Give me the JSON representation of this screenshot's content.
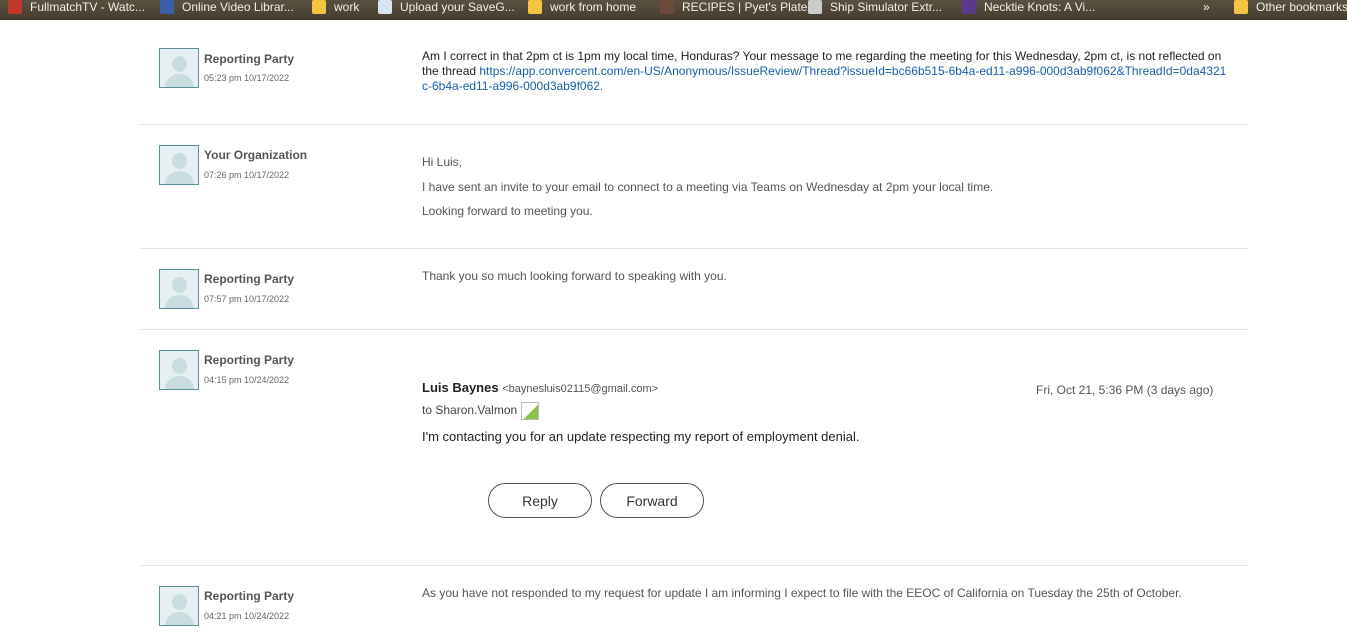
{
  "bookmarks": [
    {
      "label": "FullmatchTV - Watc...",
      "color": "#c0392b"
    },
    {
      "label": "Online Video Librar...",
      "color": "#3b5fa8"
    },
    {
      "label": "work",
      "color": "#f5c542"
    },
    {
      "label": "Upload your SaveG...",
      "color": "#d8e4f0"
    },
    {
      "label": "work from home",
      "color": "#f5c542"
    },
    {
      "label": "RECIPES | Pyet's Plate",
      "color": "#6b4a3a"
    },
    {
      "label": "Ship Simulator Extr...",
      "color": "#cccccc"
    },
    {
      "label": "Necktie Knots: A Vi...",
      "color": "#5b3a8c"
    }
  ],
  "bookmarks_overflow": "»",
  "other_bookmarks": "Other bookmarks",
  "messages": [
    {
      "author": "Reporting Party",
      "time": "05:23 pm 10/17/2022",
      "text": "Am I correct in that 2pm ct is 1pm my local time, Honduras? Your message to me regarding the meeting for this Wednesday, 2pm ct, is not reflected on the thread ",
      "link": "https://app.convercent.com/en-US/Anonymous/IssueReview/Thread?issueId=bc66b515-6b4a-ed11-a996-000d3ab9f062&ThreadId=0da4321c-6b4a-ed11-a996-000d3ab9f062."
    },
    {
      "author": "Your Organization",
      "time": "07:26 pm 10/17/2022",
      "lines": [
        "Hi Luis,",
        "I have sent an invite to your email to connect to a meeting via Teams on Wednesday at 2pm your local time.",
        "Looking forward to meeting you."
      ]
    },
    {
      "author": "Reporting Party",
      "time": "07:57 pm 10/17/2022",
      "text": "Thank you so much looking forward to speaking with you."
    },
    {
      "author": "Reporting Party",
      "time": "04:15 pm 10/24/2022",
      "email": {
        "sender": "Luis Baynes",
        "address": "<baynesluis02115@gmail.com>",
        "date": "Fri, Oct 21, 5:36 PM (3 days ago)",
        "to": "to Sharon.Valmon",
        "body": "I'm contacting you for an update respecting my report of  employment denial.",
        "reply": "Reply",
        "forward": "Forward"
      }
    },
    {
      "author": "Reporting Party",
      "time": "04:21 pm 10/24/2022",
      "text": "As you have not responded to my request for update I am informing I expect to file with the EEOC of California on Tuesday the 25th of October."
    }
  ]
}
